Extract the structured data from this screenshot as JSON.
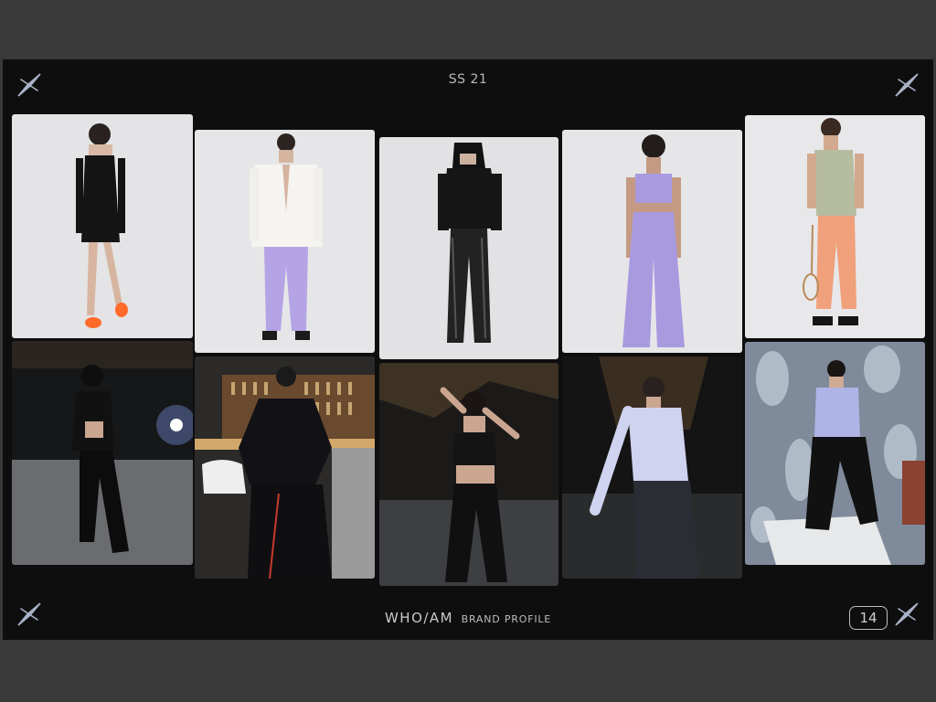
{
  "header": {
    "season": "SS 21"
  },
  "footer": {
    "brand": "WHO/AM",
    "subtitle": "BRAND PROFILE",
    "page_number": "14"
  },
  "icons": {
    "corner": "sparkle-star-icon"
  },
  "colors": {
    "background": "#0e0e0f",
    "frame": "#3a3a3a",
    "text": "#c9c9c9",
    "accent_lavender": "#a99ae0"
  }
}
